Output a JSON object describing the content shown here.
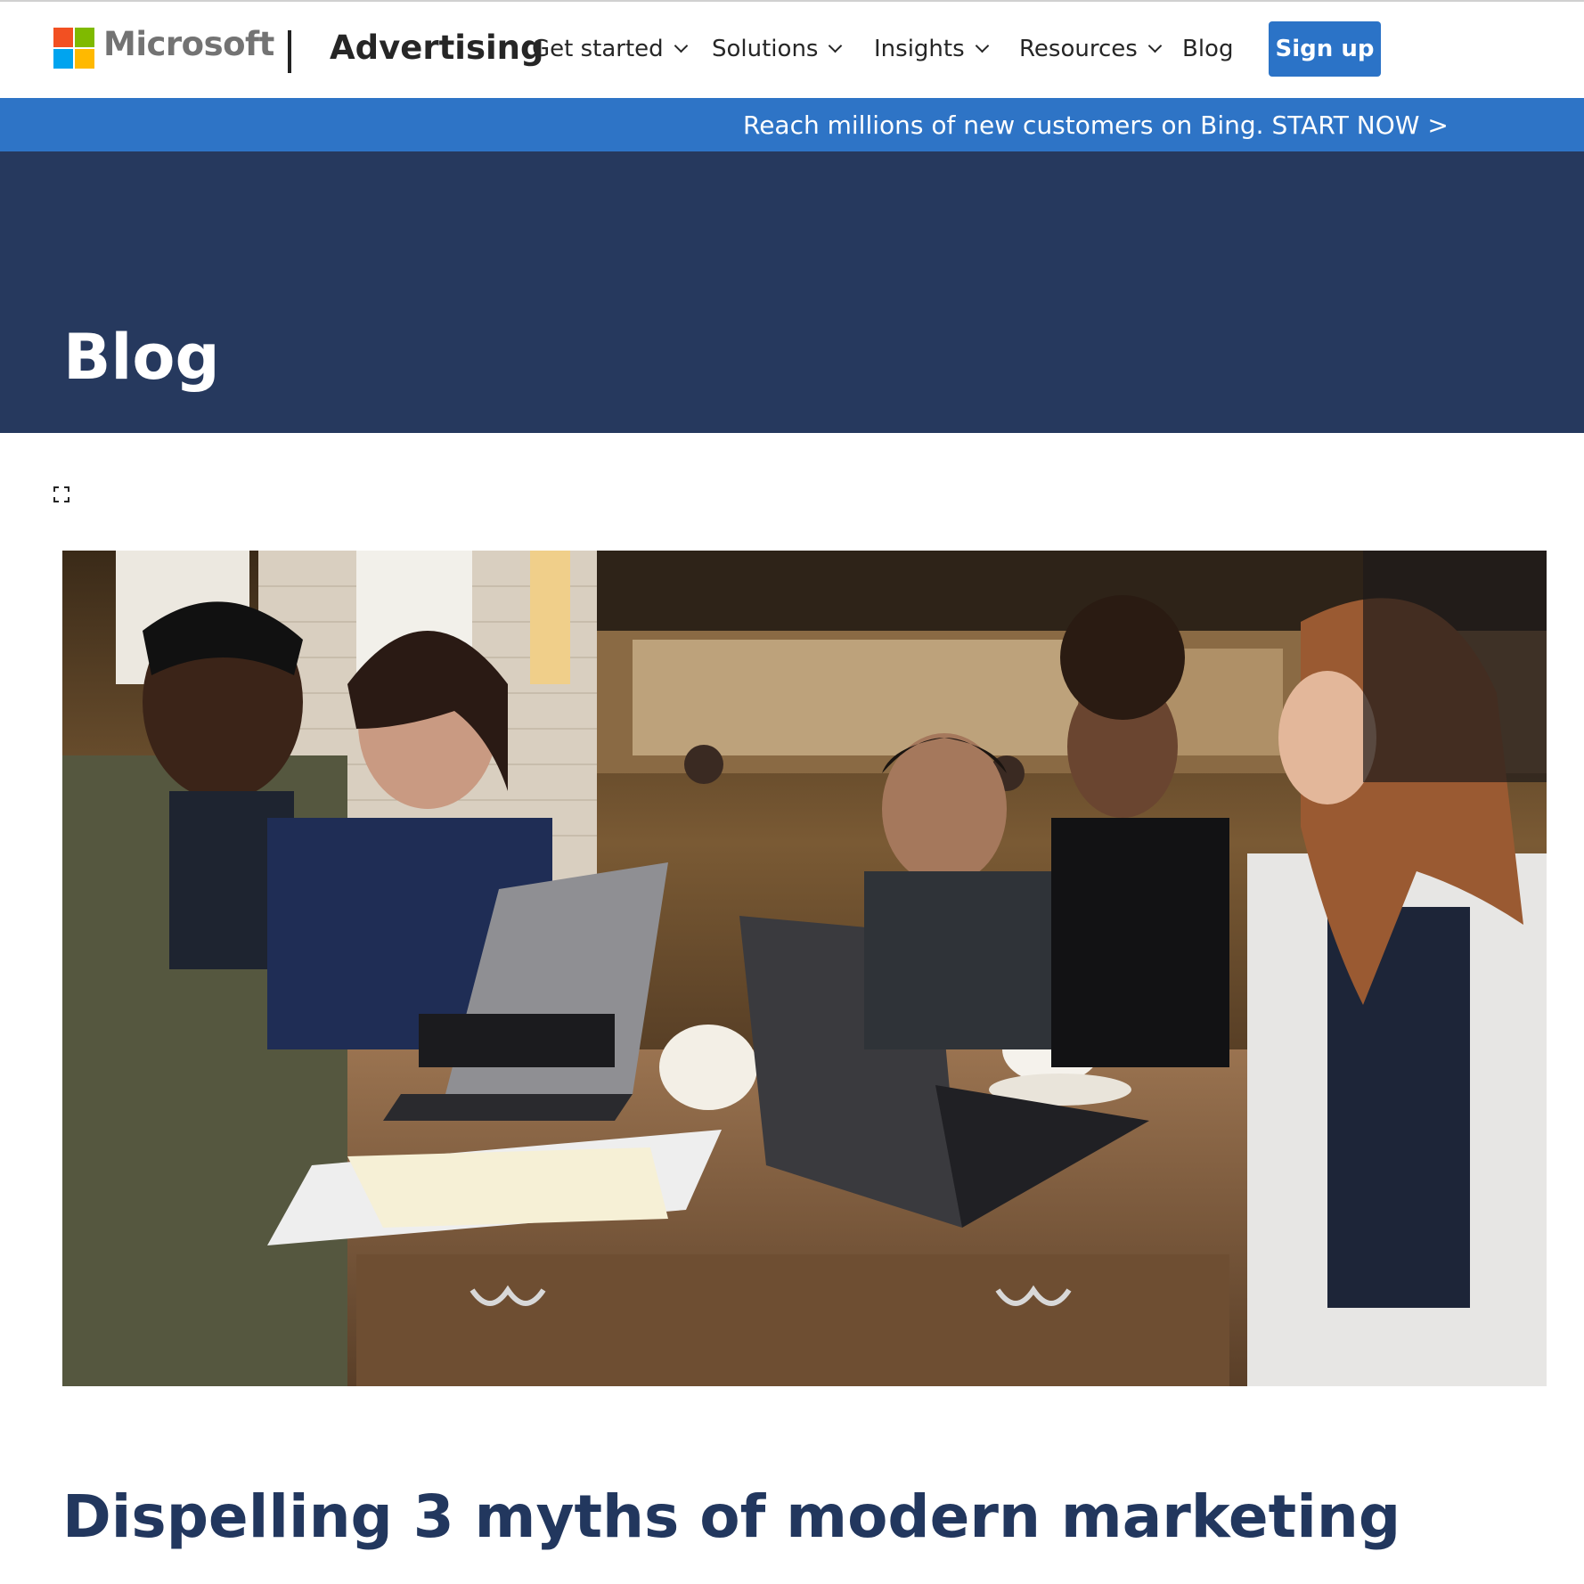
{
  "header": {
    "logo_word": "Microsoft",
    "brand": "Advertising",
    "nav": [
      {
        "label": "Get started",
        "has_dropdown": true
      },
      {
        "label": "Solutions",
        "has_dropdown": true
      },
      {
        "label": "Insights",
        "has_dropdown": true
      },
      {
        "label": "Resources",
        "has_dropdown": true
      },
      {
        "label": "Blog",
        "has_dropdown": false
      }
    ],
    "signup_label": "Sign up"
  },
  "promo": {
    "text": "Reach millions of new customers on Bing. START NOW >"
  },
  "hero": {
    "title": "Blog"
  },
  "article": {
    "title": "Dispelling 3 myths of modern marketing"
  },
  "icons": {
    "logo": "microsoft-four-squares",
    "nav_dropdown": "chevron-down-icon",
    "media_toggle": "expand-icon"
  },
  "colors": {
    "logo_red": "#f25022",
    "logo_green": "#7fba00",
    "logo_blue": "#00a4ef",
    "logo_yellow": "#ffb900",
    "signup_button": "#2b73c7",
    "promo_bar": "#2e74c6",
    "hero_background": "#26395e",
    "article_title": "#22375e"
  }
}
